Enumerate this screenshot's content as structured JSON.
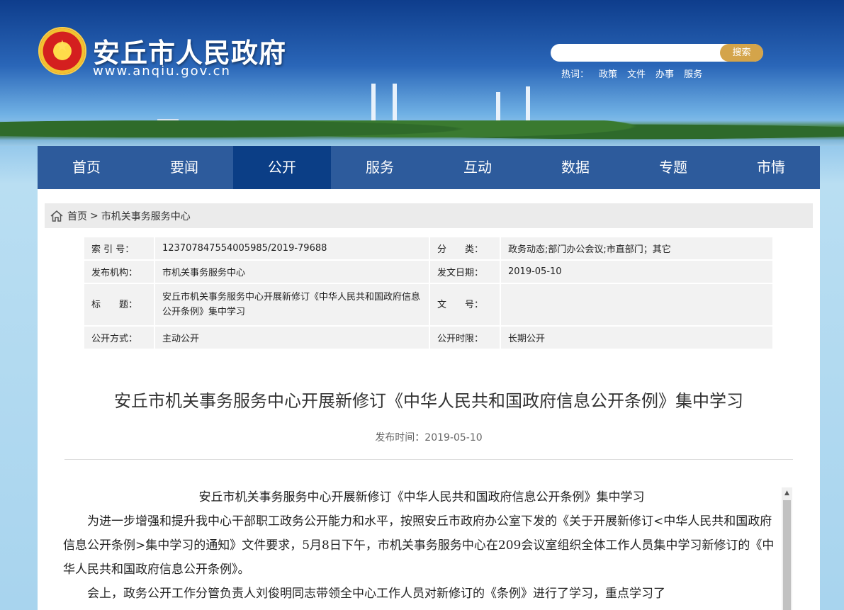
{
  "header": {
    "site_name": "安丘市人民政府",
    "site_url": "www.anqiu.gov.cn",
    "search": {
      "placeholder": "",
      "button_label": "搜索"
    },
    "hotwords_label": "热词：",
    "hotwords": [
      "政策",
      "文件",
      "办事",
      "服务"
    ]
  },
  "nav": {
    "items": [
      "首页",
      "要闻",
      "公开",
      "服务",
      "互动",
      "数据",
      "专题",
      "市情"
    ],
    "active_index": 2
  },
  "breadcrumb": {
    "home": "首页",
    "separator": ">",
    "current": "市机关事务服务中心"
  },
  "meta": {
    "index_label": "索 引 号：",
    "index_value": "123707847554005985/2019-79688",
    "category_label": "分　　类：",
    "category_value": "政务动态;部门办公会议;市直部门；其它",
    "publisher_label": "发布机构：",
    "publisher_value": "市机关事务服务中心",
    "date_label": "发文日期：",
    "date_value": "2019-05-10",
    "title_label": "标　　题：",
    "title_value": "安丘市机关事务服务中心开展新修订《中华人民共和国政府信息公开条例》集中学习",
    "docno_label": "文　　号：",
    "docno_value": "",
    "method_label": "公开方式：",
    "method_value": "主动公开",
    "period_label": "公开时限：",
    "period_value": "长期公开"
  },
  "article": {
    "title": "安丘市机关事务服务中心开展新修订《中华人民共和国政府信息公开条例》集中学习",
    "pub_time": "发布时间：2019-05-10",
    "paragraphs": [
      "安丘市机关事务服务中心开展新修订《中华人民共和国政府信息公开条例》集中学习",
      "为进一步增强和提升我中心干部职工政务公开能力和水平，按照安丘市政府办公室下发的《关于开展新修订<中华人民共和国政府信息公开条例>集中学习的通知》文件要求，5月8日下午，市机关事务服务中心在209会议室组织全体工作人员集中学习新修订的《中华人民共和国政府信息公开条例》。",
      "会上，政务公开工作分管负责人刘俊明同志带领全中心工作人员对新修订的《条例》进行了学习，重点学习了"
    ]
  },
  "colors": {
    "nav_bg": "#2d5b9c",
    "nav_active": "#0b3e86",
    "search_button": "#d4a44a"
  }
}
